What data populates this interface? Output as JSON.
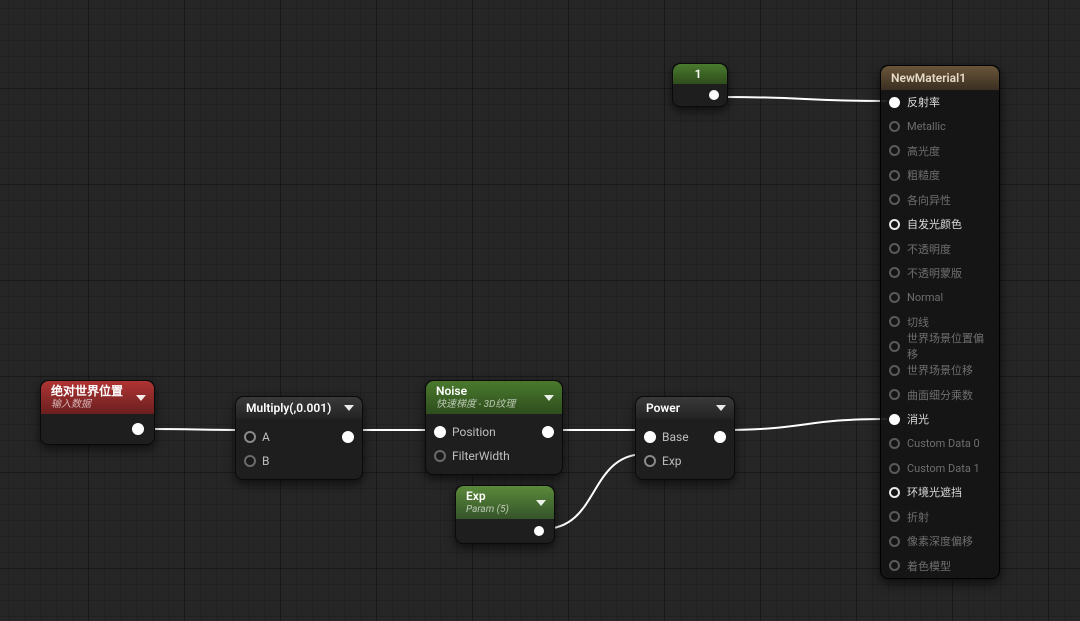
{
  "nodes": {
    "worldpos": {
      "title": "绝对世界位置",
      "subtitle": "输入数据"
    },
    "multiply": {
      "title": "Multiply(,0.001)",
      "pinA": "A",
      "pinB": "B"
    },
    "noise": {
      "title": "Noise",
      "subtitle": "快速梯度 - 3D纹理",
      "pinPos": "Position",
      "pinFW": "FilterWidth"
    },
    "exp": {
      "title": "Exp",
      "subtitle": "Param (5)"
    },
    "power": {
      "title": "Power",
      "pinBase": "Base",
      "pinExp": "Exp"
    },
    "const1": {
      "value": "1"
    }
  },
  "material": {
    "title": "NewMaterial1",
    "pins": [
      {
        "label": "反射率",
        "active": true,
        "filled": true
      },
      {
        "label": "Metallic",
        "active": false
      },
      {
        "label": "高光度",
        "active": false
      },
      {
        "label": "粗糙度",
        "active": false
      },
      {
        "label": "各向异性",
        "active": false
      },
      {
        "label": "自发光颜色",
        "active": true
      },
      {
        "label": "不透明度",
        "active": false
      },
      {
        "label": "不透明蒙版",
        "active": false
      },
      {
        "label": "Normal",
        "active": false
      },
      {
        "label": "切线",
        "active": false
      },
      {
        "label": "世界场景位置偏移",
        "active": false
      },
      {
        "label": "世界场景位移",
        "active": false
      },
      {
        "label": "曲面细分乘数",
        "active": false
      },
      {
        "label": "消光",
        "active": true,
        "filled": true
      },
      {
        "label": "Custom Data 0",
        "active": false
      },
      {
        "label": "Custom Data 1",
        "active": false
      },
      {
        "label": "环境光遮挡",
        "active": true
      },
      {
        "label": "折射",
        "active": false
      },
      {
        "label": "像素深度偏移",
        "active": false
      },
      {
        "label": "着色模型",
        "active": false
      }
    ]
  }
}
